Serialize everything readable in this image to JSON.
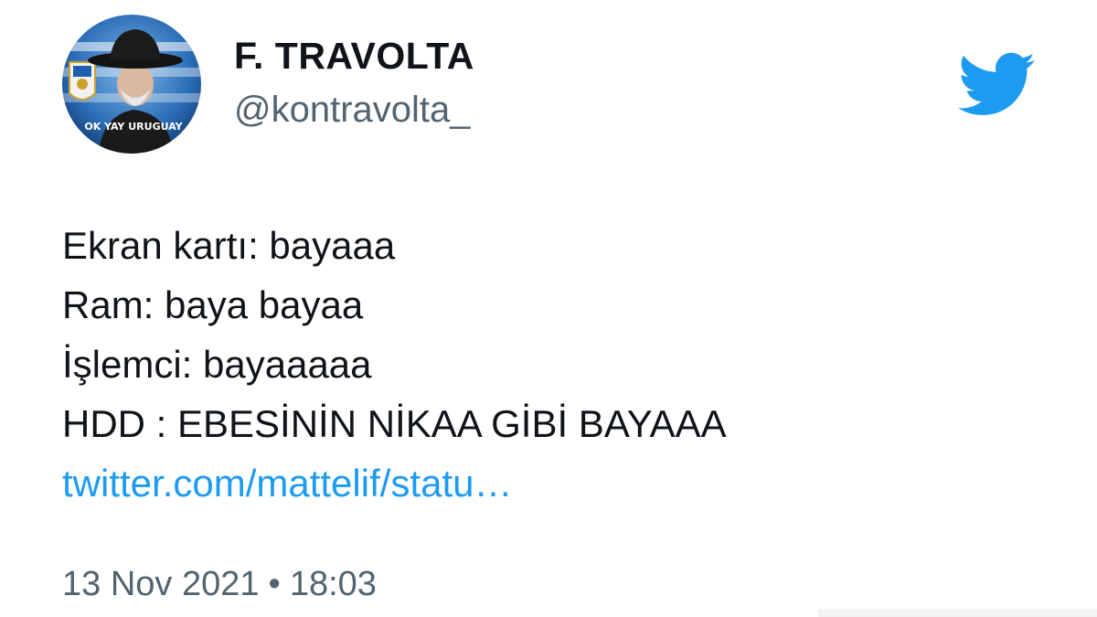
{
  "colors": {
    "text": "#0f1419",
    "secondary": "#536471",
    "link": "#1d9bf0",
    "twitter_blue": "#1d9bf0"
  },
  "user": {
    "display_name": "F. TRAVOLTA",
    "handle": "@kontravolta_",
    "avatar_icon": "avatar",
    "avatar_caption": "OK YAY URUGUAY"
  },
  "brand": {
    "icon": "twitter-bird-icon"
  },
  "tweet": {
    "lines": [
      "Ekran kartı: bayaaa",
      "Ram: baya bayaa",
      "İşlemci: bayaaaaa",
      "HDD : EBESİNİN NİKAA GİBİ BAYAAA"
    ],
    "link": "twitter.com/mattelif/statu…",
    "date": "13 Nov 2021",
    "separator": "•",
    "time": "18:03"
  }
}
